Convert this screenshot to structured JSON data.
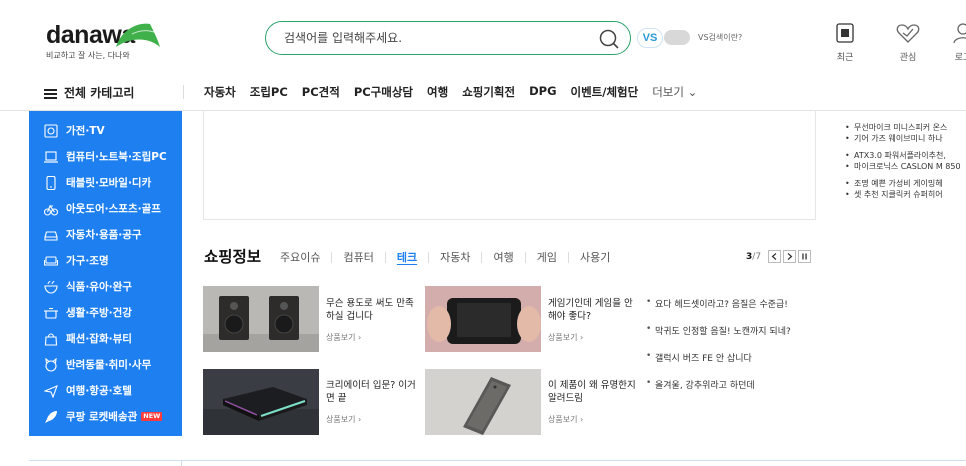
{
  "header": {
    "logo_text": "danawa",
    "logo_tagline": "비교하고 잘 사는, 다나와",
    "search_placeholder": "검색어를 입력해주세요.",
    "vs_label": "VS",
    "vs_help": "VS검색이란?",
    "utils": [
      {
        "label": "최근",
        "icon": "recent-icon"
      },
      {
        "label": "관심",
        "icon": "heart-icon"
      },
      {
        "label": "로그",
        "icon": "user-icon"
      }
    ]
  },
  "nav": {
    "all_categories": "전체 카테고리",
    "items": [
      "자동차",
      "조립PC",
      "PC견적",
      "PC구매상담",
      "여행",
      "쇼핑기획전",
      "DPG",
      "이벤트/체험단"
    ],
    "more": "더보기 ⌄"
  },
  "categories": [
    {
      "label": "가전·TV",
      "icon": "tv-icon"
    },
    {
      "label": "컴퓨터·노트북·조립PC",
      "icon": "laptop-icon"
    },
    {
      "label": "태블릿·모바일·디카",
      "icon": "phone-icon"
    },
    {
      "label": "아웃도어·스포츠·골프",
      "icon": "bike-icon"
    },
    {
      "label": "자동차·용품·공구",
      "icon": "car-icon"
    },
    {
      "label": "가구·조명",
      "icon": "sofa-icon"
    },
    {
      "label": "식품·유아·완구",
      "icon": "food-icon"
    },
    {
      "label": "생활·주방·건강",
      "icon": "pot-icon"
    },
    {
      "label": "패션·잡화·뷰티",
      "icon": "bag-icon"
    },
    {
      "label": "반려동물·취미·사무",
      "icon": "pet-icon"
    },
    {
      "label": "여행·항공·호텔",
      "icon": "plane-icon"
    },
    {
      "label": "쿠팡 로켓배송관",
      "icon": "rocket-icon",
      "badge": "NEW"
    }
  ],
  "news": [
    "무선마이크 미니스피커 온스",
    "기어 가즈 웨이브미니 하나",
    "ATX3.0 파워서플라이추천,",
    "마이크로닉스 CASLON M 850",
    "조명 예쁜 가성비 게이밍헤",
    "셋 추천 지클릭커 슈퍼히어"
  ],
  "shopping": {
    "title": "쇼핑정보",
    "tabs": [
      "주요이슈",
      "컴퓨터",
      "테크",
      "자동차",
      "여행",
      "게임",
      "사용기"
    ],
    "active_tab": 2,
    "pager": {
      "current": "3",
      "sep": "/",
      "total": "7"
    },
    "cards": [
      {
        "title": "무슨 용도로 써도 만족하실 겁니다",
        "link": "상품보기 ›"
      },
      {
        "title": "게임기인데 게임을 안 해야 좋다?",
        "link": "상품보기 ›"
      },
      {
        "title": "크리에이터 입문? 이거면 끝",
        "link": "상품보기 ›"
      },
      {
        "title": "이 제품이 왜 유명한지 알려드림",
        "link": "상품보기 ›"
      }
    ],
    "side_links": [
      "요다 헤드셋이라고? 음질은 수준급!",
      "막귀도 인정할 음질! 노캔까지 되네?",
      "갤럭시 버즈 FE 안 삽니다",
      "올겨울, 강추위라고 하던데"
    ]
  },
  "colors": {
    "brand_green": "#2aa36b",
    "accent_blue": "#1e7ff0"
  }
}
